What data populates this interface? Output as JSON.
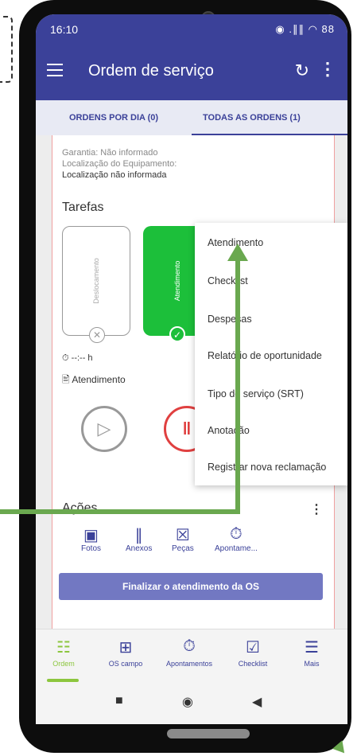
{
  "status_bar": {
    "time": "16:10",
    "indicators": "◉ .∥∥ ◠ 88"
  },
  "app_bar": {
    "title": "Ordem de serviço"
  },
  "tabs": [
    {
      "label": "ORDENS POR DIA (0)"
    },
    {
      "label": "TODAS AS ORDENS (1)"
    }
  ],
  "details": {
    "faded_line": "Garantia: Não informado",
    "location_label": "Localização do Equipamento:",
    "location_value": "Localização não informada"
  },
  "tasks_section": {
    "title": "Tarefas",
    "cards": [
      {
        "label": "Deslocamento"
      },
      {
        "label": "Atendimento"
      }
    ],
    "timer": "--:-- h",
    "current_task": "Atendimento"
  },
  "popup_menu": {
    "items": [
      "Atendimento",
      "Checklist",
      "Despesas",
      "Relatório de oportunidade",
      "Tipo de serviço (SRT)",
      "Anotação",
      "Registrar nova reclamação"
    ]
  },
  "actions_section": {
    "title": "Ações",
    "buttons": [
      {
        "label": "Fotos",
        "icon": "camera-icon"
      },
      {
        "label": "Anexos",
        "icon": "paperclip-icon"
      },
      {
        "label": "Peças",
        "icon": "part-icon"
      },
      {
        "label": "Apontame...",
        "icon": "stopwatch-icon"
      }
    ],
    "finalize_label": "Finalizar o atendimento da OS"
  },
  "bottom_nav": [
    {
      "label": "Ordem",
      "icon": "clipboard-icon"
    },
    {
      "label": "OS campo",
      "icon": "clipboard-plus-icon"
    },
    {
      "label": "Apontamentos",
      "icon": "stopwatch-icon"
    },
    {
      "label": "Checklist",
      "icon": "checklist-icon"
    },
    {
      "label": "Mais",
      "icon": "menu-icon"
    }
  ],
  "colors": {
    "primary": "#3b4199",
    "success": "#1cbf3a",
    "danger": "#e04040",
    "nav_active": "#8cc63e",
    "annotation_arrow": "#6aa84f"
  }
}
